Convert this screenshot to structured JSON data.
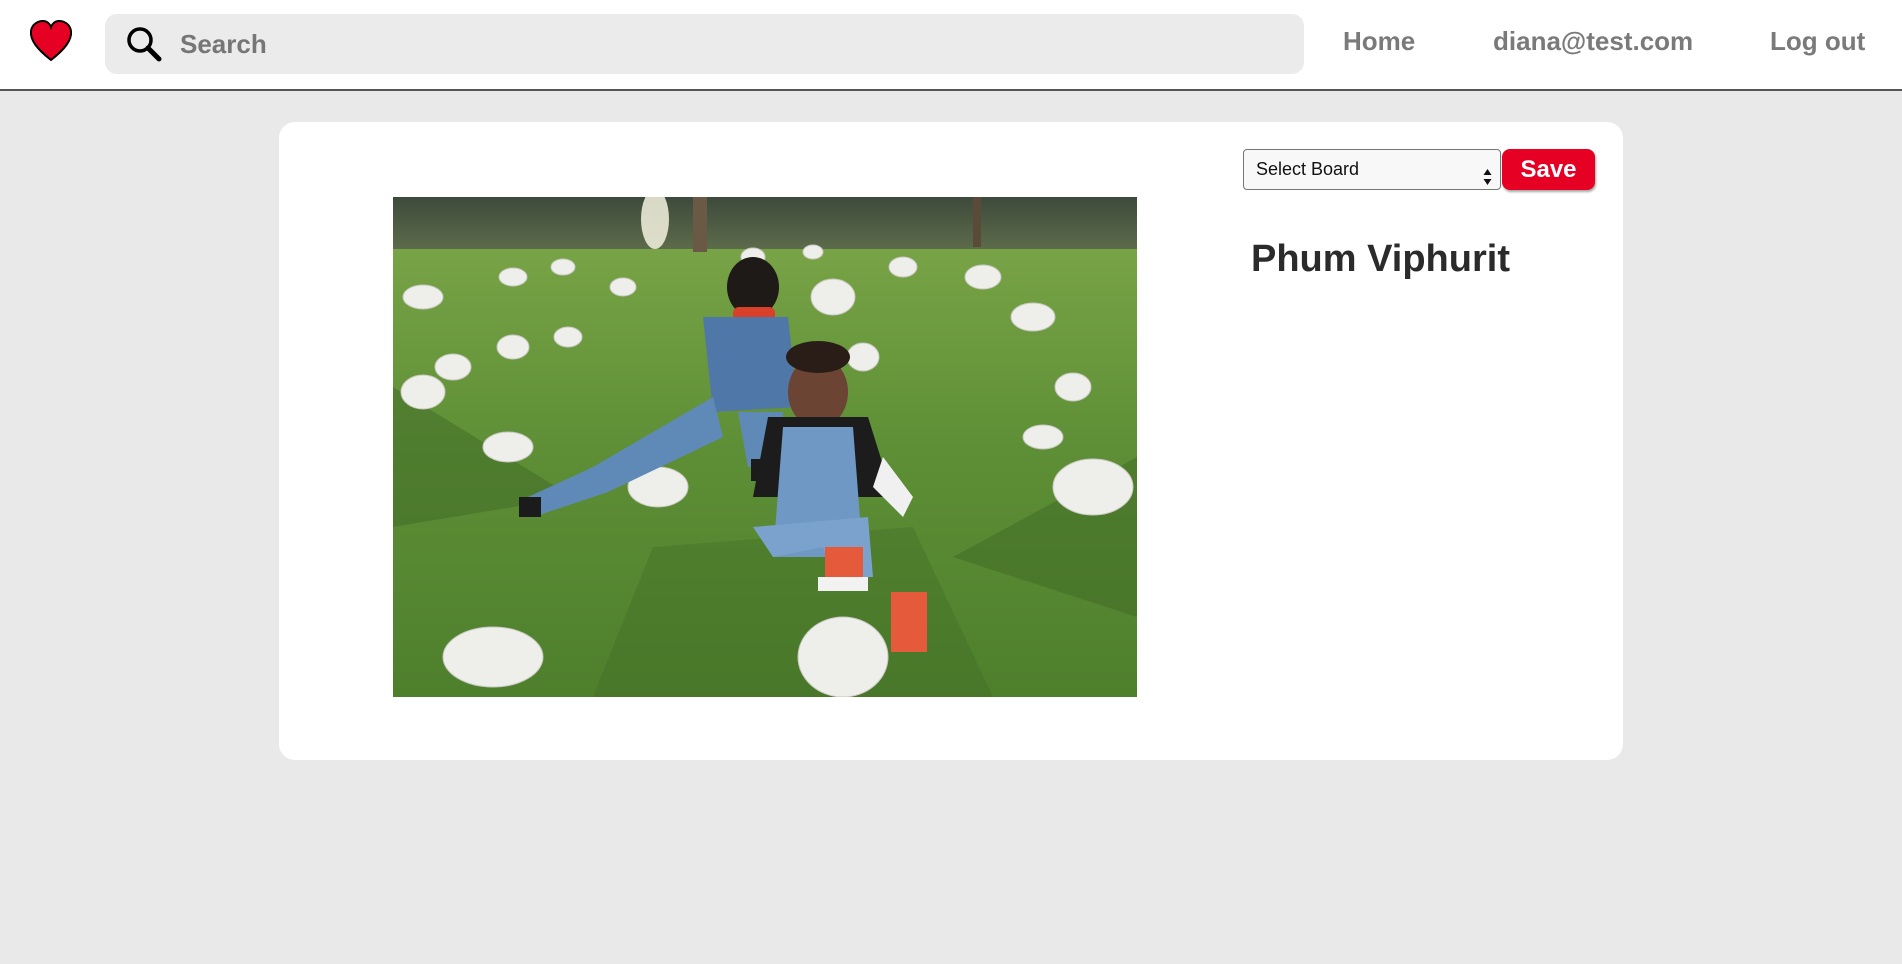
{
  "header": {
    "logo_icon": "heart-icon",
    "logo_color": "#e60023",
    "search": {
      "icon": "search-icon",
      "placeholder": "Search",
      "value": ""
    },
    "nav": {
      "home_label": "Home",
      "user_label": "diana@test.com",
      "logout_label": "Log out"
    }
  },
  "pin": {
    "title": "Phum Viphurit",
    "image_icon": "photo-image",
    "board_select": {
      "selected": "Select Board",
      "icon": "select-arrows-icon"
    },
    "save_label": "Save",
    "accent_color": "#e60023"
  }
}
